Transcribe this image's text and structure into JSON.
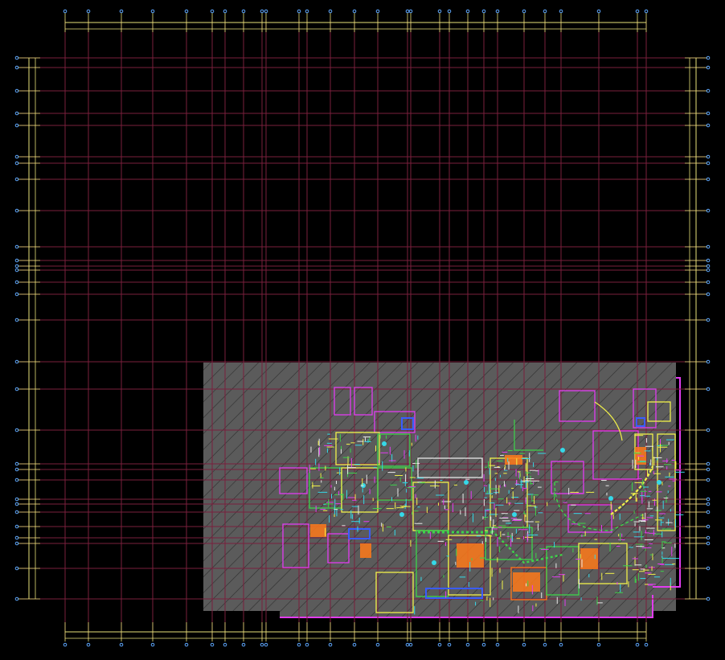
{
  "viewport": {
    "background": "#000000"
  },
  "colors": {
    "grid_line": "#7a1f3d",
    "dimension": "#e8e27a",
    "grid_bubble": "#5fa8ff",
    "hatch_fill": "#5b5b5b",
    "hatch_line": "#3a3a3a",
    "wall_magenta": "#e23cf0",
    "wall_yellow": "#f2f24a",
    "wall_green": "#3dd44a",
    "wall_cyan": "#35d8e8",
    "wall_orange": "#ff7a1a",
    "wall_blue": "#3a5cff",
    "wall_white": "#e8e8e8"
  },
  "layers": {
    "grid": "axis-grid",
    "dimensions": "dimension-lines",
    "floor_slab": "floor-slab-hatch",
    "plan": "floor-plan-geometry"
  },
  "icons": {
    "grid_bubble": "circle-marker-icon"
  }
}
